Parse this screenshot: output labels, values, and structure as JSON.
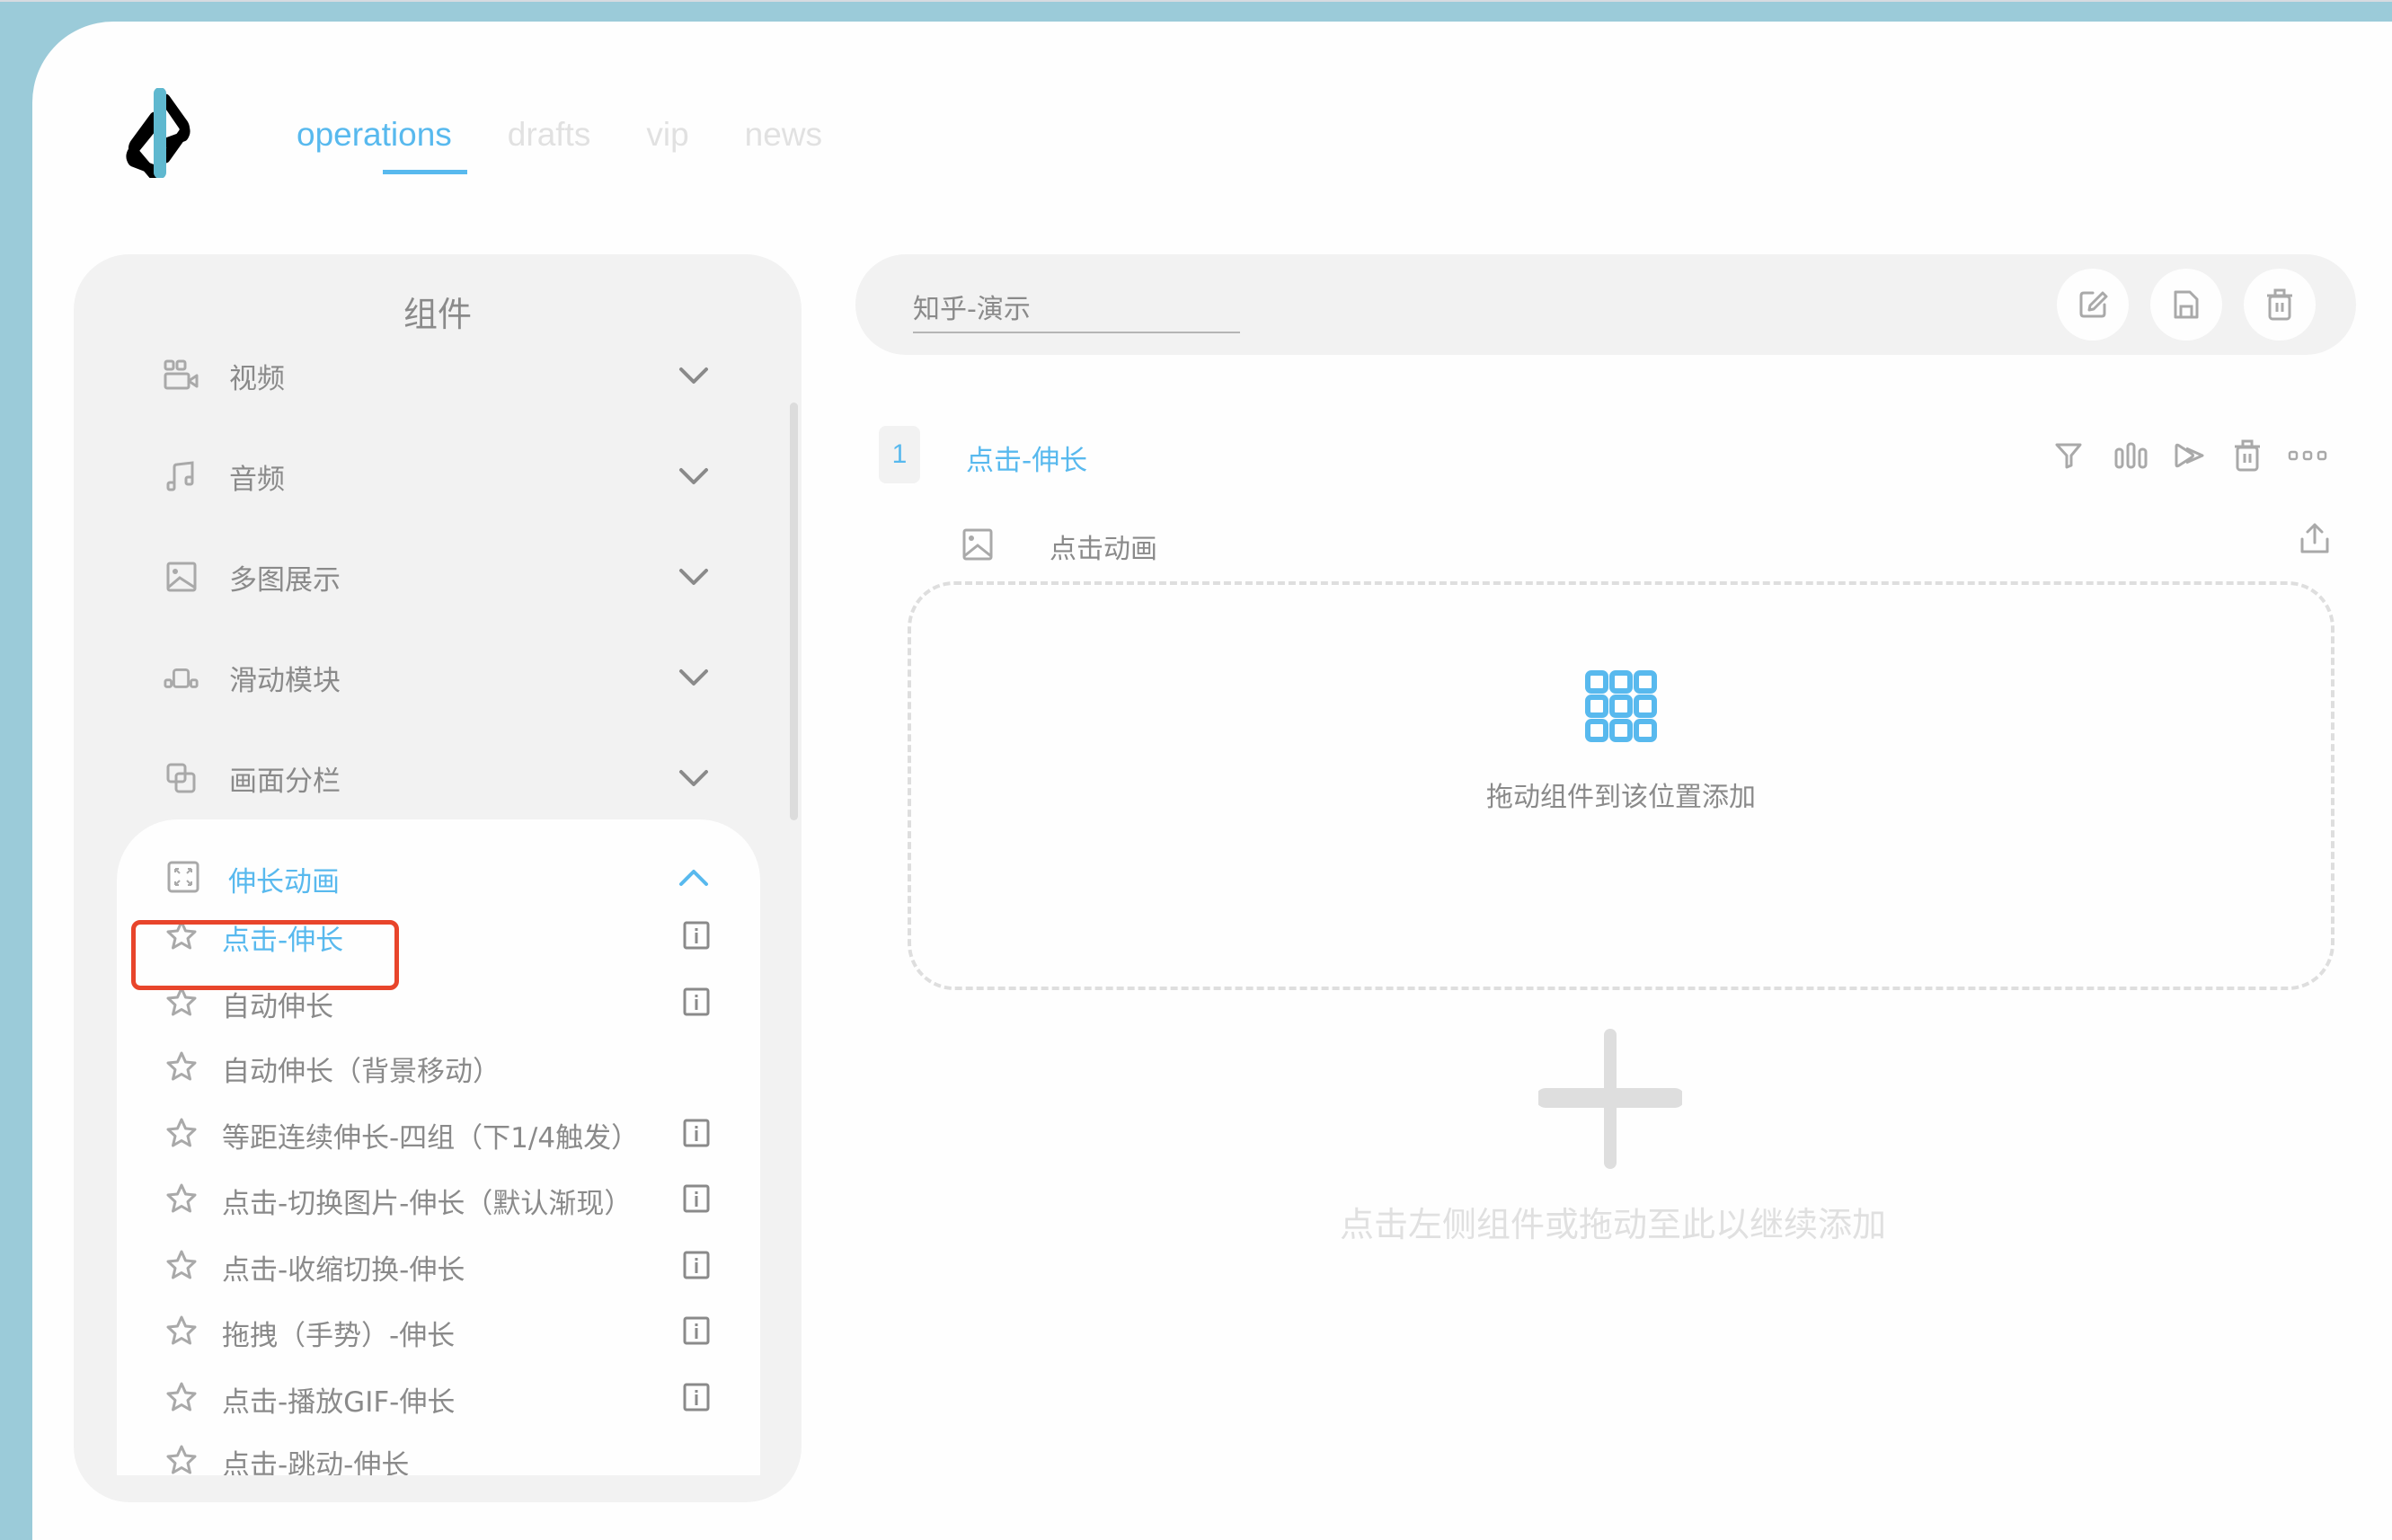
{
  "colors": {
    "accent": "#58b9ee",
    "frame": "#9bcbd9",
    "muted": "#8a8a8a",
    "highlight": "#e8452b",
    "panel": "#f2f2f2"
  },
  "nav": {
    "tabs": [
      {
        "label": "operations",
        "active": true
      },
      {
        "label": "drafts",
        "active": false
      },
      {
        "label": "vip",
        "active": false
      },
      {
        "label": "news",
        "active": false
      }
    ]
  },
  "sidebar": {
    "title": "组件",
    "categories": [
      {
        "label": "视频",
        "icon": "video-icon",
        "expanded": false
      },
      {
        "label": "音频",
        "icon": "music-icon",
        "expanded": false
      },
      {
        "label": "多图展示",
        "icon": "image-icon",
        "expanded": false
      },
      {
        "label": "滑动模块",
        "icon": "slider-icon",
        "expanded": false
      },
      {
        "label": "画面分栏",
        "icon": "split-icon",
        "expanded": false
      }
    ],
    "expanded_category": {
      "label": "伸长动画",
      "icon": "expand-icon",
      "items": [
        {
          "label": "点击-伸长",
          "selected": true,
          "has_info": true
        },
        {
          "label": "自动伸长",
          "selected": false,
          "has_info": true
        },
        {
          "label": "自动伸长（背景移动）",
          "selected": false,
          "has_info": false
        },
        {
          "label": "等距连续伸长-四组（下1/4触发）",
          "selected": false,
          "has_info": true
        },
        {
          "label": "点击-切换图片-伸长（默认渐现）",
          "selected": false,
          "has_info": true
        },
        {
          "label": "点击-收缩切换-伸长",
          "selected": false,
          "has_info": true
        },
        {
          "label": "拖拽（手势）-伸长",
          "selected": false,
          "has_info": true
        },
        {
          "label": "点击-播放GIF-伸长",
          "selected": false,
          "has_info": true
        },
        {
          "label": "点击-跳动-伸长",
          "selected": false,
          "has_info": false
        }
      ]
    }
  },
  "main": {
    "title_input": {
      "value": "知乎-演示"
    },
    "header_buttons": [
      "edit-icon",
      "save-icon",
      "delete-icon"
    ],
    "row": {
      "index": "1",
      "title": "点击-伸长",
      "actions": [
        "filter-icon",
        "bars-icon",
        "forward-icon",
        "delete-icon",
        "more-icon"
      ],
      "sub_label": "点击动画",
      "dropzone_text": "拖动组件到该位置添加"
    },
    "add_hint": "点击左侧组件或拖动至此以继续添加"
  }
}
